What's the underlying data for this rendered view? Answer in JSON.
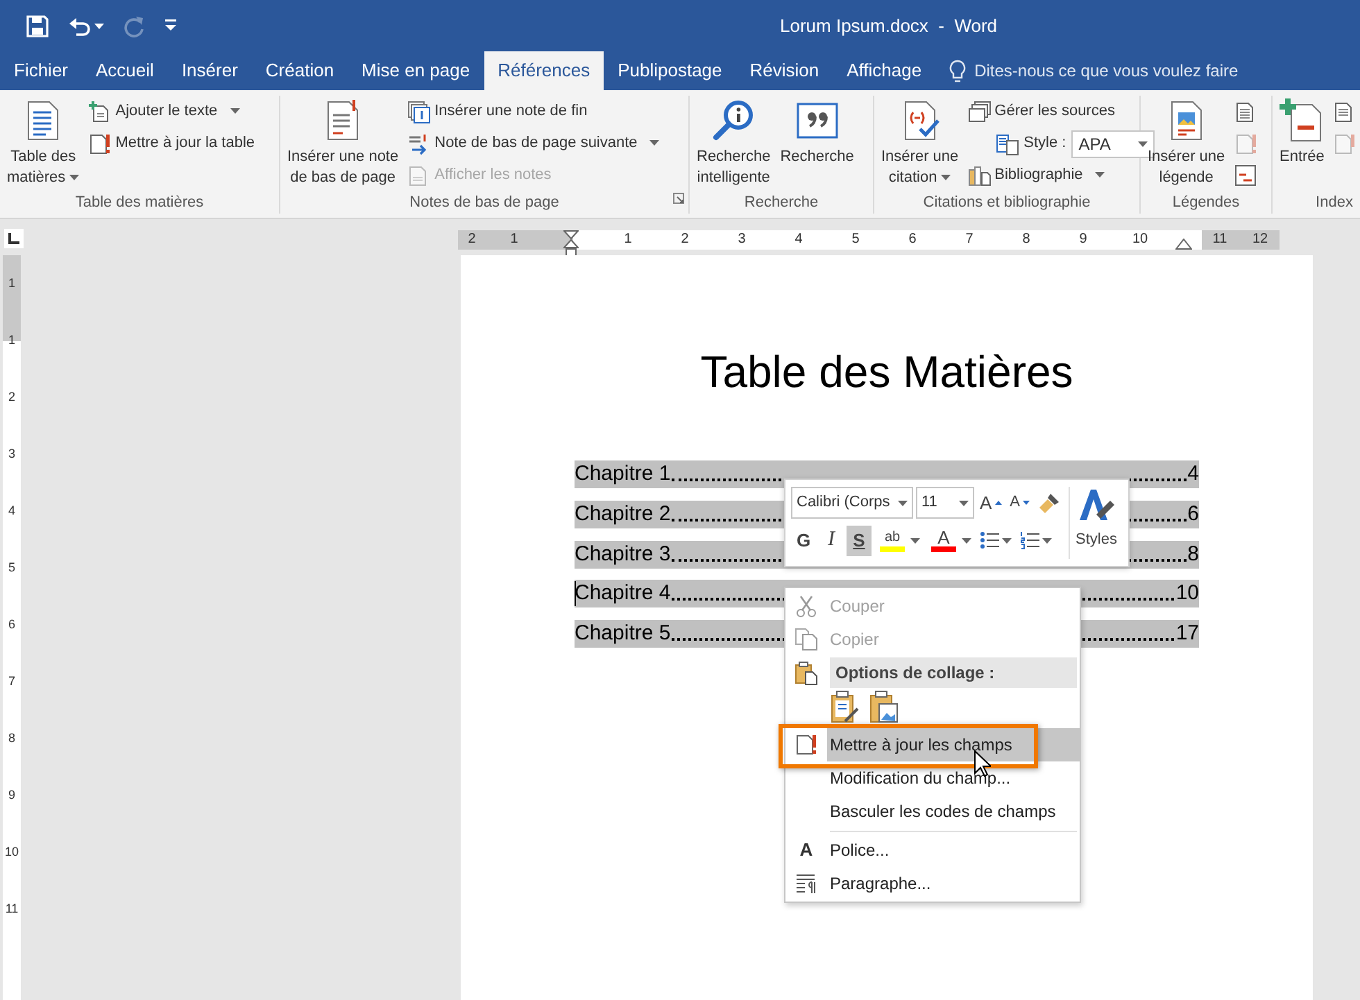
{
  "quick_access": [
    {
      "disabled": false
    },
    {
      "disabled": false
    },
    {
      "disabled": true
    },
    {
      "disabled": false
    }
  ],
  "window": {
    "title": "Lorum Ipsum.docx  -  Word"
  },
  "tabs": [
    {
      "label": "Fichier",
      "selected": false
    },
    {
      "label": "Accueil",
      "selected": false
    },
    {
      "label": "Insérer",
      "selected": false
    },
    {
      "label": "Création",
      "selected": false
    },
    {
      "label": "Mise en page",
      "selected": false
    },
    {
      "label": "Références",
      "selected": true
    },
    {
      "label": "Publipostage",
      "selected": false
    },
    {
      "label": "Révision",
      "selected": false
    },
    {
      "label": "Affichage",
      "selected": false
    }
  ],
  "tell_me": {
    "placeholder": "Dites-nous ce que vous voulez faire"
  },
  "ribbon": {
    "groups": [
      {
        "label": "Table des matières",
        "columns": [
          {
            "items": [
              {
                "kind": "large",
                "label": "Table des\nmatières",
                "dropdown": true,
                "disabled": false
              }
            ]
          },
          {
            "items": [
              {
                "kind": "small",
                "label": "Ajouter le texte",
                "dropdown": true,
                "disabled": false
              },
              {
                "kind": "small",
                "label": "Mettre à jour la table",
                "dropdown": false,
                "disabled": false
              }
            ]
          }
        ]
      },
      {
        "label": "Notes de bas de page",
        "launcher": true,
        "columns": [
          {
            "items": [
              {
                "kind": "large",
                "label": "Insérer une note\nde bas de page",
                "dropdown": false,
                "disabled": false
              }
            ]
          },
          {
            "items": [
              {
                "kind": "small",
                "label": "Insérer une note de fin",
                "dropdown": false,
                "disabled": false
              },
              {
                "kind": "small",
                "label": "Note de bas de page suivante",
                "dropdown": true,
                "disabled": false
              },
              {
                "kind": "small",
                "label": "Afficher les notes",
                "dropdown": false,
                "disabled": true
              }
            ]
          }
        ]
      },
      {
        "label": "Recherche",
        "columns": [
          {
            "items": [
              {
                "kind": "large",
                "label": "Recherche\nintelligente",
                "dropdown": false,
                "disabled": false
              }
            ]
          },
          {
            "items": [
              {
                "kind": "large",
                "label": "Recherche",
                "dropdown": false,
                "disabled": false
              }
            ]
          }
        ]
      },
      {
        "label": "Citations et bibliographie",
        "columns": [
          {
            "items": [
              {
                "kind": "large",
                "label": "Insérer une\ncitation",
                "dropdown": true,
                "disabled": false
              }
            ]
          },
          {
            "items": [
              {
                "kind": "small",
                "label": "Gérer les sources",
                "dropdown": false,
                "disabled": false
              },
              {
                "kind": "combo",
                "label": "Style :",
                "value": "APA"
              },
              {
                "kind": "small",
                "label": "Bibliographie",
                "dropdown": true,
                "disabled": false
              }
            ]
          }
        ]
      },
      {
        "label": "Légendes",
        "columns": [
          {
            "items": [
              {
                "kind": "large",
                "label": "Insérer une\nlégende",
                "dropdown": false,
                "disabled": false
              }
            ]
          },
          {
            "items": [
              {
                "kind": "icon",
                "disabled": false
              },
              {
                "kind": "icon",
                "disabled": true
              },
              {
                "kind": "icon",
                "disabled": false
              }
            ]
          }
        ]
      },
      {
        "label": "Index",
        "columns": [
          {
            "items": [
              {
                "kind": "large",
                "label": "Entrée",
                "dropdown": false,
                "disabled": false
              }
            ]
          },
          {
            "items": [
              {
                "kind": "icon",
                "disabled": false
              },
              {
                "kind": "icon",
                "disabled": true
              }
            ]
          }
        ]
      }
    ]
  },
  "horizontal_ruler": {
    "marks": [
      {
        "kind": "number",
        "text": "2"
      },
      {
        "kind": "number",
        "text": "1"
      },
      {
        "kind": "indent"
      },
      {
        "kind": "number",
        "text": "1"
      },
      {
        "kind": "number",
        "text": "2"
      },
      {
        "kind": "number",
        "text": "3"
      },
      {
        "kind": "number",
        "text": "4"
      },
      {
        "kind": "number",
        "text": "5"
      },
      {
        "kind": "number",
        "text": "6"
      },
      {
        "kind": "number",
        "text": "7"
      },
      {
        "kind": "number",
        "text": "8"
      },
      {
        "kind": "number",
        "text": "9"
      },
      {
        "kind": "number",
        "text": "10"
      },
      {
        "kind": "right_indent"
      },
      {
        "kind": "number",
        "text": "11"
      },
      {
        "kind": "number",
        "text": "12"
      }
    ]
  },
  "vertical_ruler": {
    "labels": [
      "1",
      "1",
      "2",
      "3",
      "4",
      "5",
      "6",
      "7",
      "8",
      "9",
      "10",
      "11"
    ]
  },
  "document": {
    "title": "Table des Matières",
    "toc": [
      {
        "label": "Chapitre 1",
        "page": "4",
        "selected": true,
        "caret": false
      },
      {
        "label": "Chapitre 2",
        "page": "6",
        "selected": true,
        "caret": false
      },
      {
        "label": "Chapitre 3",
        "page": "8",
        "selected": true,
        "caret": false
      },
      {
        "label": "Chapitre 4",
        "page": "10",
        "selected": true,
        "caret": true
      },
      {
        "label": "Chapitre 5",
        "page": "17",
        "selected": true,
        "caret": false
      }
    ]
  },
  "mini_toolbar": {
    "font": "Calibri (Corps",
    "size": "11",
    "grow": "A",
    "shrink": "A",
    "styles": "Styles",
    "buttons": [
      {
        "kind": "bold",
        "label": "G",
        "pressed": false
      },
      {
        "kind": "italic",
        "label": "I",
        "pressed": false
      },
      {
        "kind": "underline",
        "label": "S",
        "pressed": true
      },
      {
        "kind": "color",
        "label": "ab",
        "color": "#ffff00"
      },
      {
        "kind": "color",
        "label": "A",
        "color": "#ff0000"
      },
      {
        "kind": "bullets"
      },
      {
        "kind": "numbering"
      }
    ]
  },
  "context_menu": {
    "items": [
      {
        "kind": "item",
        "label": "Couper",
        "disabled": true,
        "selected": false,
        "outlined": false
      },
      {
        "kind": "item",
        "label": "Copier",
        "disabled": true,
        "selected": false,
        "outlined": false
      },
      {
        "kind": "header",
        "label": "Options de collage :"
      },
      {
        "kind": "paste"
      },
      {
        "kind": "item",
        "label": "Mettre à jour les champs",
        "disabled": false,
        "selected": true,
        "outlined": true
      },
      {
        "kind": "item",
        "label": "Modification du champ...",
        "disabled": false,
        "selected": false,
        "outlined": false
      },
      {
        "kind": "item",
        "label": "Basculer les codes de champs",
        "disabled": false,
        "selected": false,
        "outlined": false
      },
      {
        "kind": "separator"
      },
      {
        "kind": "item",
        "label": "Police...",
        "icon_text": "A",
        "disabled": false,
        "selected": false,
        "outlined": false
      },
      {
        "kind": "item",
        "label": "Paragraphe...",
        "disabled": false,
        "selected": false,
        "outlined": false
      }
    ]
  }
}
